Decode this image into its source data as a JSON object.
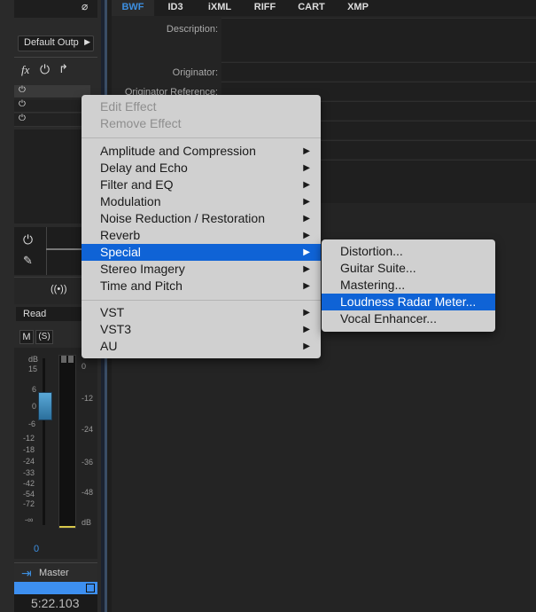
{
  "strip": {
    "output_label": "Default Outp",
    "fx_label": "fx",
    "automation_mode": "Read",
    "mute_label": "M",
    "solo_label": "(S)",
    "db_unit": "dB",
    "fader_scale": [
      "15",
      "6",
      "0",
      "-6",
      "-12",
      "-18",
      "-24",
      "-33",
      "-42",
      "-54",
      "-72",
      "-∞"
    ],
    "meter_scale": [
      "0",
      "-12",
      "-24",
      "-36",
      "-48"
    ],
    "fader_value": "0",
    "track_name": "Master",
    "time": "5:22.103"
  },
  "tabs": [
    {
      "label": "BWF",
      "active": true
    },
    {
      "label": "ID3",
      "active": false
    },
    {
      "label": "iXML",
      "active": false
    },
    {
      "label": "RIFF",
      "active": false
    },
    {
      "label": "CART",
      "active": false
    },
    {
      "label": "XMP",
      "active": false
    }
  ],
  "fields": {
    "description": "Description:",
    "originator": "Originator:",
    "originator_reference": "Originator Reference:"
  },
  "menu": {
    "edit_effect": "Edit Effect",
    "remove_effect": "Remove Effect",
    "items": [
      "Amplitude and Compression",
      "Delay and Echo",
      "Filter and EQ",
      "Modulation",
      "Noise Reduction / Restoration",
      "Reverb",
      "Special",
      "Stereo Imagery",
      "Time and Pitch"
    ],
    "plugins": [
      "VST",
      "VST3",
      "AU"
    ]
  },
  "submenu": {
    "items": [
      "Distortion...",
      "Guitar Suite...",
      "Mastering...",
      "Loudness Radar Meter...",
      "Vocal Enhancer..."
    ]
  },
  "colors": {
    "accent": "#0f63d6",
    "tab_active": "#3d8fe0",
    "meter_text": "#3d8fe0"
  }
}
